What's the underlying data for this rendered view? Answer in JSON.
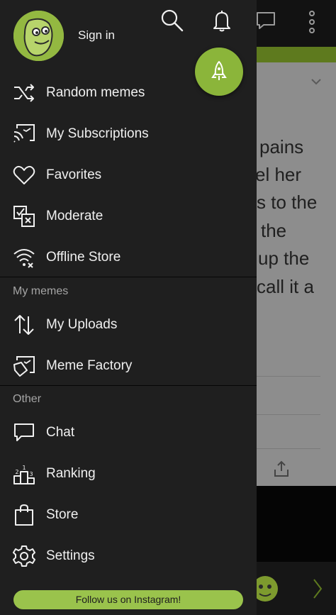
{
  "header": {
    "sign_in_label": "Sign in"
  },
  "icons": {
    "search": "search-icon",
    "notifications": "bell-icon",
    "fab": "rocket-icon",
    "chat": "chat-icon",
    "more": "more-vertical-icon"
  },
  "menu": {
    "main": [
      {
        "label": "Random memes",
        "icon": "shuffle-icon"
      },
      {
        "label": "My Subscriptions",
        "icon": "subscriptions-icon"
      },
      {
        "label": "Favorites",
        "icon": "heart-icon"
      },
      {
        "label": "Moderate",
        "icon": "moderate-icon"
      },
      {
        "label": "Offline Store",
        "icon": "wifi-off-icon"
      }
    ],
    "my_memes_title": "My memes",
    "my_memes": [
      {
        "label": "My Uploads",
        "icon": "up-down-arrows-icon"
      },
      {
        "label": "Meme Factory",
        "icon": "meme-factory-icon"
      }
    ],
    "other_title": "Other",
    "other": [
      {
        "label": "Chat",
        "icon": "chat-bubble-icon"
      },
      {
        "label": "Ranking",
        "icon": "podium-icon"
      },
      {
        "label": "Store",
        "icon": "shopping-bag-icon"
      },
      {
        "label": "Settings",
        "icon": "gear-icon"
      }
    ]
  },
  "footer": {
    "instagram_label": "Follow us on Instagram!"
  },
  "background_content": {
    "text_lines": [
      "pains",
      "el her",
      "s to the",
      "the",
      "up the",
      "call it a"
    ]
  },
  "colors": {
    "accent": "#8bb53a",
    "drawer_bg": "#1f1f1f"
  }
}
